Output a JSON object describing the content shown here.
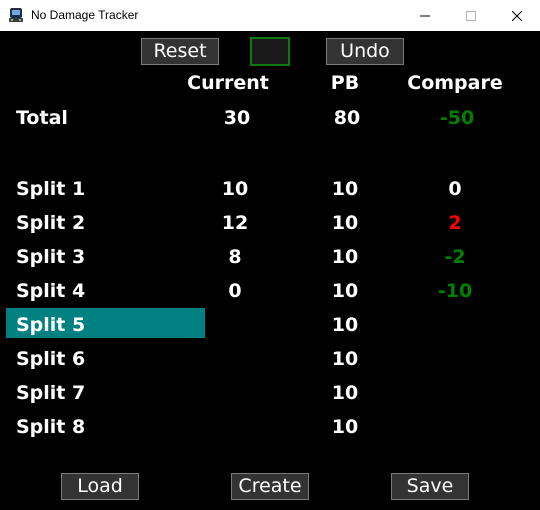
{
  "window": {
    "title": "No Damage Tracker",
    "icon": "controller-app-icon",
    "controls": [
      "minimize-icon",
      "maximize-icon",
      "close-icon"
    ]
  },
  "toolbar": {
    "reset_label": "Reset",
    "undo_label": "Undo"
  },
  "table": {
    "headers": {
      "current": "Current",
      "pb": "PB",
      "compare": "Compare"
    },
    "total": {
      "label": "Total",
      "current": "30",
      "pb": "80",
      "compare": "-50"
    },
    "splits": [
      {
        "label": "Split 1",
        "current": "10",
        "pb": "10",
        "compare": "0"
      },
      {
        "label": "Split 2",
        "current": "12",
        "pb": "10",
        "compare": "2"
      },
      {
        "label": "Split 3",
        "current": "8",
        "pb": "10",
        "compare": "-2"
      },
      {
        "label": "Split 4",
        "current": "0",
        "pb": "10",
        "compare": "-10"
      },
      {
        "label": "Split 5",
        "current": "",
        "pb": "10",
        "compare": ""
      },
      {
        "label": "Split 6",
        "current": "",
        "pb": "10",
        "compare": ""
      },
      {
        "label": "Split 7",
        "current": "",
        "pb": "10",
        "compare": ""
      },
      {
        "label": "Split 8",
        "current": "",
        "pb": "10",
        "compare": ""
      }
    ],
    "active_split": "Split 5"
  },
  "footer": {
    "load_label": "Load",
    "create_label": "Create",
    "save_label": "Save"
  },
  "colors": {
    "background": "#000000",
    "text": "#ffffff",
    "highlight": "#008080",
    "positive": "#ff0000",
    "negative": "#008000",
    "neutral": "#ffffff",
    "indicator_border": "#0e7a0e"
  }
}
